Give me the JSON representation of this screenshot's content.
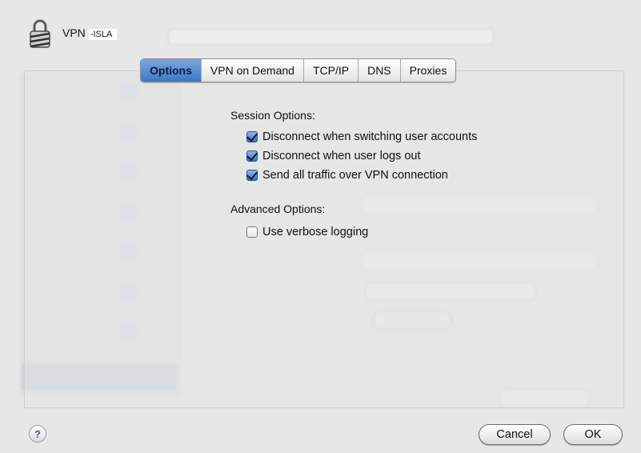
{
  "header": {
    "title": "VPN",
    "subtitle": "-ISLA"
  },
  "tabs": [
    {
      "label": "Options",
      "active": true
    },
    {
      "label": "VPN on Demand",
      "active": false
    },
    {
      "label": "TCP/IP",
      "active": false
    },
    {
      "label": "DNS",
      "active": false
    },
    {
      "label": "Proxies",
      "active": false
    }
  ],
  "session": {
    "title": "Session Options:",
    "options": [
      {
        "label": "Disconnect when switching user accounts",
        "checked": true
      },
      {
        "label": "Disconnect when user logs out",
        "checked": true
      },
      {
        "label": "Send all traffic over VPN connection",
        "checked": true
      }
    ]
  },
  "advanced": {
    "title": "Advanced Options:",
    "options": [
      {
        "label": "Use verbose logging",
        "checked": false
      }
    ]
  },
  "footer": {
    "help_glyph": "?",
    "cancel_label": "Cancel",
    "ok_label": "OK"
  },
  "colors": {
    "accent": "#3d76c6",
    "help_glyph": "#6b3fa0"
  }
}
